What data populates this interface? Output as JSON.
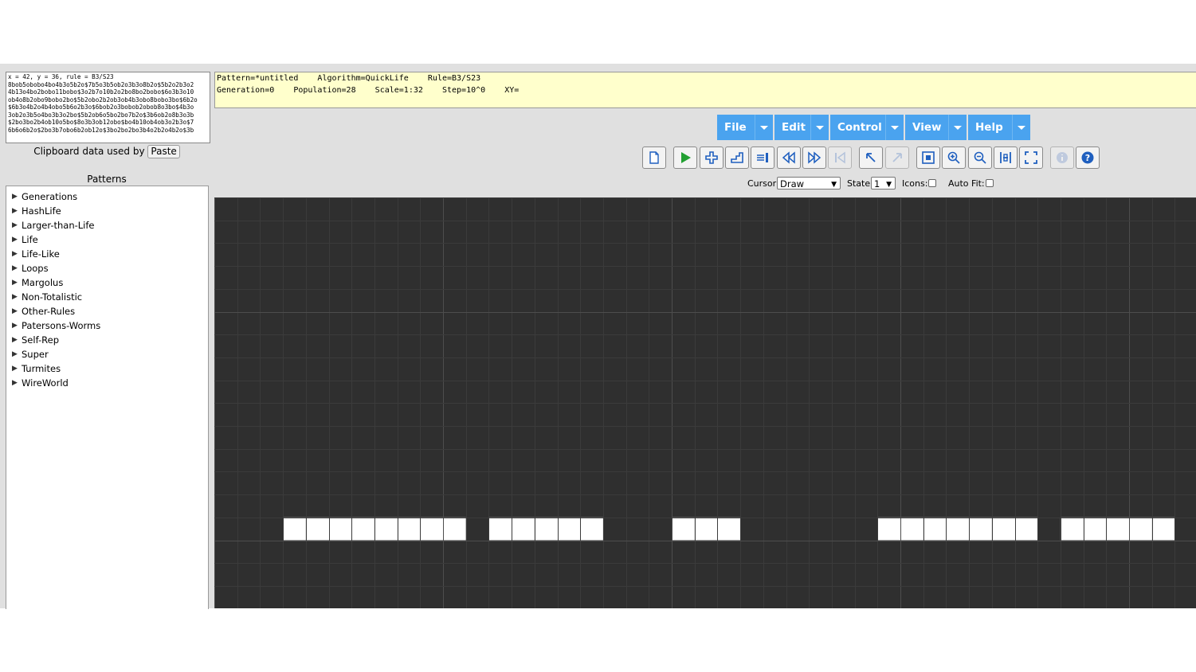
{
  "clipboard": {
    "lines": [
      "x = 42, y = 36, rule = B3/S23",
      "8bob5obobo4bo4b3o5b2o$7b5o3b5ob2o3b3o8b2o$5b2o2b3o2",
      "4b13o4bo2bobo11bobo$3o2b7o10b2o2bo8bo2bobo$6o3b3o10",
      "ob4o8b2obo9bobo2bo$5b2obo2b2ob3ob4b3obo8bobo3bo$6b2o",
      "$6b3o4b2o4b4obo5b6o2b3o$6bob2o3bobob2obob8o3bo$4b3o",
      "3ob2o3b5o4bo3b3o2bo$5b2ob6o5bo2bo7b2o$3b6ob2o8b3o3b",
      "$2bo3bo2b4ob10o5bo$8o3b3ob12obo$bo4b10ob4ob3o2b3o$7",
      "6b6o6b2o$2bo3b7obo6b2ob12o$3bo2bo2bo3b4o2b2o4b2o$3b"
    ],
    "label": "Clipboard data used by",
    "paste_button": "Paste"
  },
  "patterns": {
    "title": "Patterns",
    "items": [
      "Generations",
      "HashLife",
      "Larger-than-Life",
      "Life",
      "Life-Like",
      "Loops",
      "Margolus",
      "Non-Totalistic",
      "Other-Rules",
      "Patersons-Worms",
      "Self-Rep",
      "Super",
      "Turmites",
      "WireWorld"
    ]
  },
  "status": {
    "line1": "Pattern=*untitled    Algorithm=QuickLife    Rule=B3/S23",
    "line2": "Generation=0    Population=28    Scale=1:32    Step=10^0    XY="
  },
  "menu": {
    "items": [
      {
        "label": "File"
      },
      {
        "label": "Edit"
      },
      {
        "label": "Control"
      },
      {
        "label": "View"
      },
      {
        "label": "Help"
      }
    ]
  },
  "toolbar": {
    "icons": [
      "new-pattern-icon",
      "start-icon",
      "next-generation-icon",
      "next-step-icon",
      "reset-icon",
      "slower-icon",
      "faster-icon",
      "go-to-start-icon",
      "undo-icon",
      "redo-icon",
      "fit-pattern-icon",
      "zoom-in-icon",
      "zoom-out-icon",
      "fit-selection-icon",
      "fullscreen-icon",
      "info-icon",
      "help-icon"
    ]
  },
  "controls": {
    "cursor_label": "Cursor:",
    "cursor_value": "Draw",
    "state_label": "State:",
    "state_value": "1",
    "icons_label": "Icons:",
    "autofit_label": "Auto Fit:"
  },
  "grid": {
    "cell_size": 28.7,
    "live_row": 14,
    "live_cells": [
      3,
      4,
      5,
      6,
      7,
      8,
      9,
      10,
      12,
      13,
      14,
      15,
      16,
      20,
      21,
      22,
      29,
      30,
      31,
      32,
      33,
      34,
      35,
      37,
      38,
      39,
      40,
      41
    ],
    "colors": {
      "background": "#2f2f2f",
      "minor_line": "#3b3b3b",
      "major_line": "#4d4d4d",
      "live": "#ffffff"
    }
  }
}
